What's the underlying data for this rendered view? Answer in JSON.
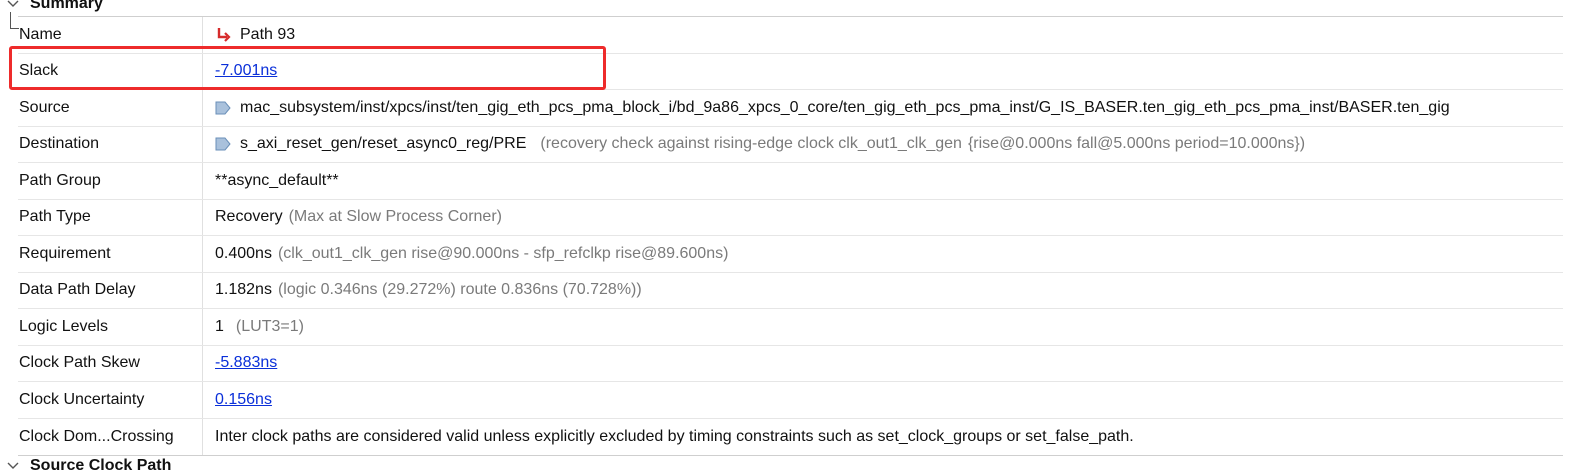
{
  "summary_header": {
    "title": "Summary"
  },
  "next_section_header": {
    "title": "Source Clock Path"
  },
  "rows": {
    "name": {
      "label": "Name",
      "value": "Path 93",
      "icon": "path-arrow-icon"
    },
    "slack": {
      "label": "Slack",
      "value": "-7.001ns"
    },
    "source": {
      "label": "Source",
      "value": "mac_subsystem/inst/xpcs/inst/ten_gig_eth_pcs_pma_block_i/bd_9a86_xpcs_0_core/ten_gig_eth_pcs_pma_inst/G_IS_BASER.ten_gig_eth_pcs_pma_inst/BASER.ten_gig",
      "icon": "pin-icon"
    },
    "destination": {
      "label": "Destination",
      "value": "s_axi_reset_gen/reset_async0_reg/PRE",
      "detail": "(recovery check against rising-edge clock clk_out1_clk_gen",
      "clock": "{rise@0.000ns fall@5.000ns period=10.000ns})",
      "icon": "pin-icon"
    },
    "path_group": {
      "label": "Path Group",
      "value": "**async_default**"
    },
    "path_type": {
      "label": "Path Type",
      "value": "Recovery",
      "detail": "(Max at Slow Process Corner)"
    },
    "requirement": {
      "label": "Requirement",
      "value": "0.400ns",
      "detail": "(clk_out1_clk_gen rise@90.000ns - sfp_refclkp rise@89.600ns)"
    },
    "data_path_delay": {
      "label": "Data Path Delay",
      "value": "1.182ns",
      "detail": "(logic 0.346ns (29.272%)  route 0.836ns (70.728%))"
    },
    "logic_levels": {
      "label": "Logic Levels",
      "value": "1",
      "detail": "(LUT3=1)"
    },
    "clock_path_skew": {
      "label": "Clock Path Skew",
      "value": "-5.883ns"
    },
    "clock_uncertainty": {
      "label": "Clock Uncertainty",
      "value": "0.156ns"
    },
    "clock_domain_crossing": {
      "label": "Clock Dom...Crossing",
      "value": "Inter clock paths are considered valid unless explicitly excluded by timing constraints such as set_clock_groups or set_false_path."
    }
  },
  "colors": {
    "link": "#0a2fd9",
    "highlight": "#ee2b2b",
    "muted": "#7a7a7a",
    "path_icon": "#d62b2b",
    "pin_icon": "#6a8fb8"
  }
}
